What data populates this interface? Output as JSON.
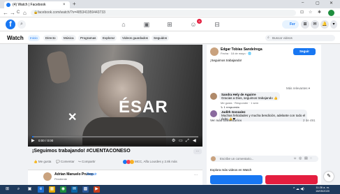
{
  "browser": {
    "tab_title": "(4) Watch | Facebook",
    "tab_close": "×",
    "new_tab": "+",
    "url": "facebook.com/watch/?v=485341959443733",
    "nav": {
      "back": "←",
      "forward": "→",
      "reload": "C",
      "home": "⌂"
    },
    "window_controls": {
      "minimize": "–",
      "maximize": "▢",
      "close": "✕"
    }
  },
  "fb_header": {
    "logo": "f",
    "search_icon": "⌕",
    "nav_icons": [
      "⌂",
      "▣",
      "⊞",
      "☺",
      "⊟"
    ],
    "badge_count": "9",
    "me_label": "Fer",
    "right_icons": [
      "⊞",
      "✉",
      "🔔",
      "▾"
    ]
  },
  "watch_bar": {
    "title": "Watch",
    "tabs": [
      "Inicio",
      "Directo",
      "Música",
      "Programas",
      "Explorar",
      "Videos guardados",
      "Seguidos"
    ],
    "search_placeholder": "Buscar videos"
  },
  "video": {
    "overlay_text": "ÉSAR",
    "time": "0:00 / 0:00",
    "title": "¡Seguimos trabajando! #CUENTACONESO",
    "more": "···",
    "progress": 0.01,
    "actions": [
      "Me gusta",
      "Comentar",
      "Compartir"
    ],
    "reactions_text": "MCC, Alfa Lourdes y 2.8k más",
    "next": {
      "name": "Adrian Manuelo Pruneo",
      "follow": "Seguir",
      "sub": "Pendiente"
    }
  },
  "panel": {
    "author_name": "Edgar Tobías Sandelrega",
    "author_meta": "Fecha · 18 de mayo · 🌐",
    "follow_label": "Seguir",
    "post_text": "¡Seguimos trabajando!",
    "sort_label": "Más relevantes ▾",
    "comments": [
      {
        "name": "Sandra Hely de Aguirre",
        "text": "Gracias a Dios, seguimos trabajando 👍",
        "actions": "Me gusta · Responder · 1 sem",
        "replies": "↳ 1 respuesta",
        "color": "#b08a6a"
      },
      {
        "name": "Judith Gonzalez",
        "text": "Muchas felicidades y mucha bendición, adelante con todo el",
        "text2": "éxito 👍❤",
        "actions": "Me gusta · Responder · 1 sem",
        "replies": "",
        "color": "#8a6a9e"
      }
    ],
    "more_comments": "Ver más comentarios",
    "count": "2 de 491",
    "input_placeholder": "Escribe un comentario...",
    "input_icons": [
      "☺",
      "◎",
      "▤",
      "◌"
    ],
    "explore_text": "Explora más videos en Watch"
  },
  "taskbar": {
    "time": "11:26 a. m.",
    "date": "18/05/2020",
    "tray": "^ ☁ ◀)",
    "icons": [
      "⊞",
      "⌕",
      "▣",
      "e",
      "▦",
      "◉",
      "✉",
      "▩",
      "▶"
    ]
  },
  "colors": {
    "accent": "#1877f2",
    "taskbar": "#1f3a5c",
    "background": "#f0f2f5"
  }
}
